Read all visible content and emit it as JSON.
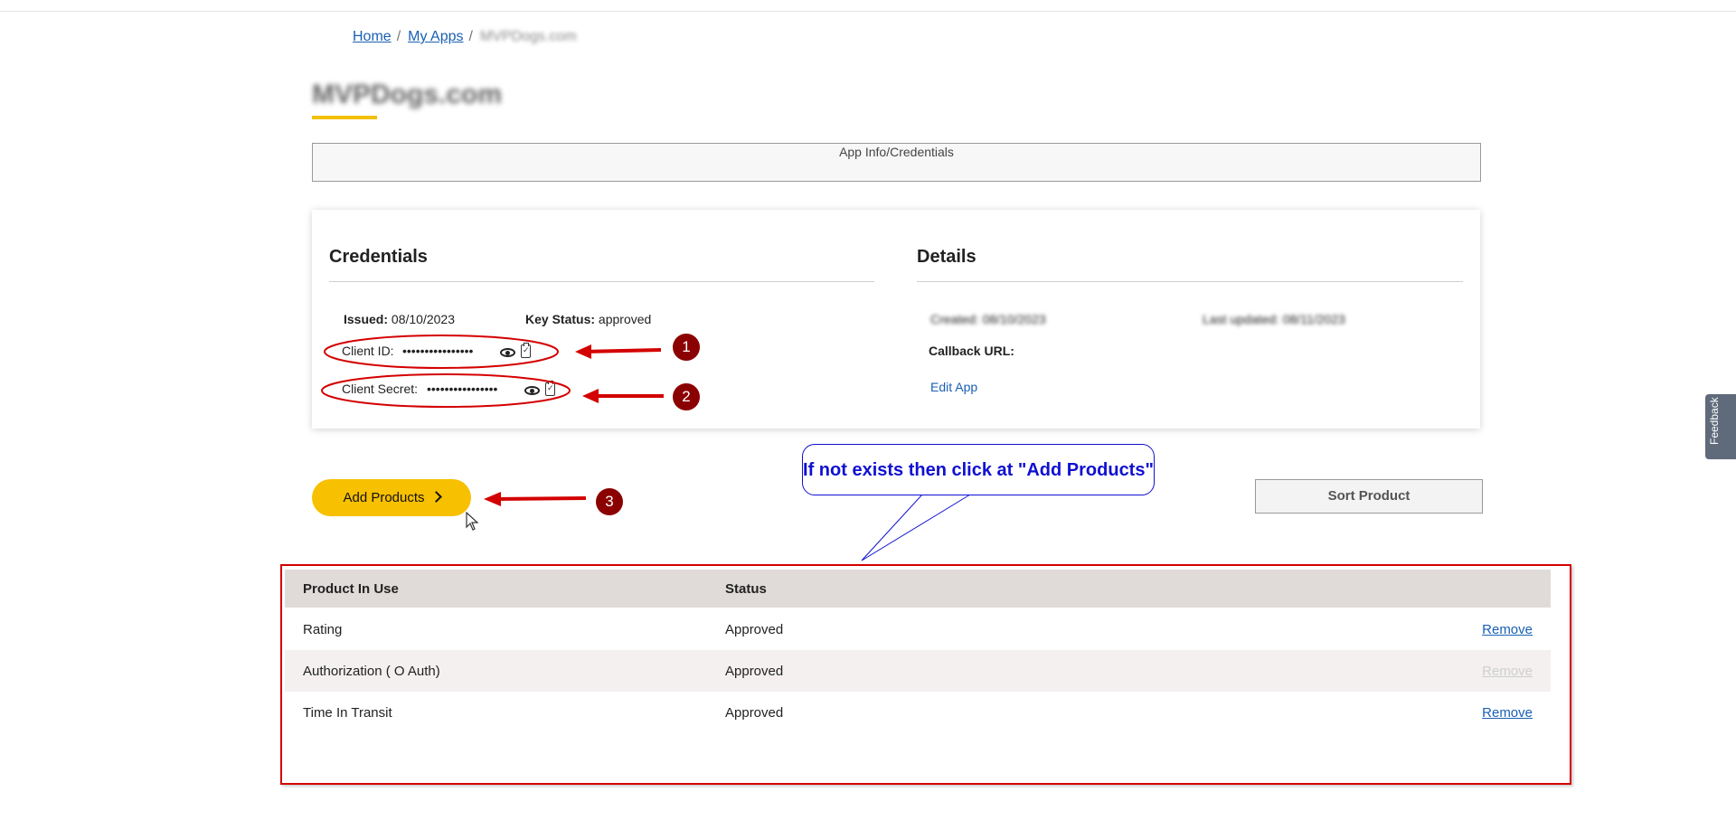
{
  "breadcrumb": {
    "items": [
      "Home",
      "My Apps"
    ],
    "current": "MVPDogs.com"
  },
  "page": {
    "title": "MVPDogs.com"
  },
  "tabs": [
    {
      "label": "App Info/Credentials"
    }
  ],
  "credentials": {
    "title": "Credentials",
    "issued_label": "Issued:",
    "issued_value": "08/10/2023",
    "key_status_label": "Key Status:",
    "key_status_value": "approved",
    "client_id_label": "Client ID:",
    "client_id_value": "••••••••••••••••",
    "client_secret_label": "Client Secret:",
    "client_secret_value": "••••••••••••••••"
  },
  "details": {
    "title": "Details",
    "created_label": "Created: 08/10/2023",
    "last_updated_label": "Last updated: 08/11/2023",
    "callback_label": "Callback URL:",
    "edit_app_label": "Edit App"
  },
  "actions": {
    "add_products_label": "Add Products",
    "sort_product_label": "Sort Product"
  },
  "annotation": {
    "callout_text": "If not exists then click at \"Add Products\"",
    "badges": [
      "1",
      "2",
      "3"
    ],
    "color": "#d40000"
  },
  "products_table": {
    "headers": [
      "Product In Use",
      "Status"
    ],
    "rows": [
      {
        "product": "Rating",
        "status": "Approved",
        "action": "Remove",
        "enabled": true
      },
      {
        "product": "Authorization ( O Auth)",
        "status": "Approved",
        "action": "Remove",
        "enabled": false
      },
      {
        "product": "Time In Transit",
        "status": "Approved",
        "action": "Remove",
        "enabled": true
      }
    ]
  },
  "feedback_tab": {
    "label": "Feedback"
  },
  "colors": {
    "accent": "#f7c000",
    "link": "#1a5fb4",
    "annotation_red": "#d40000",
    "callout_blue": "#1010d0"
  }
}
